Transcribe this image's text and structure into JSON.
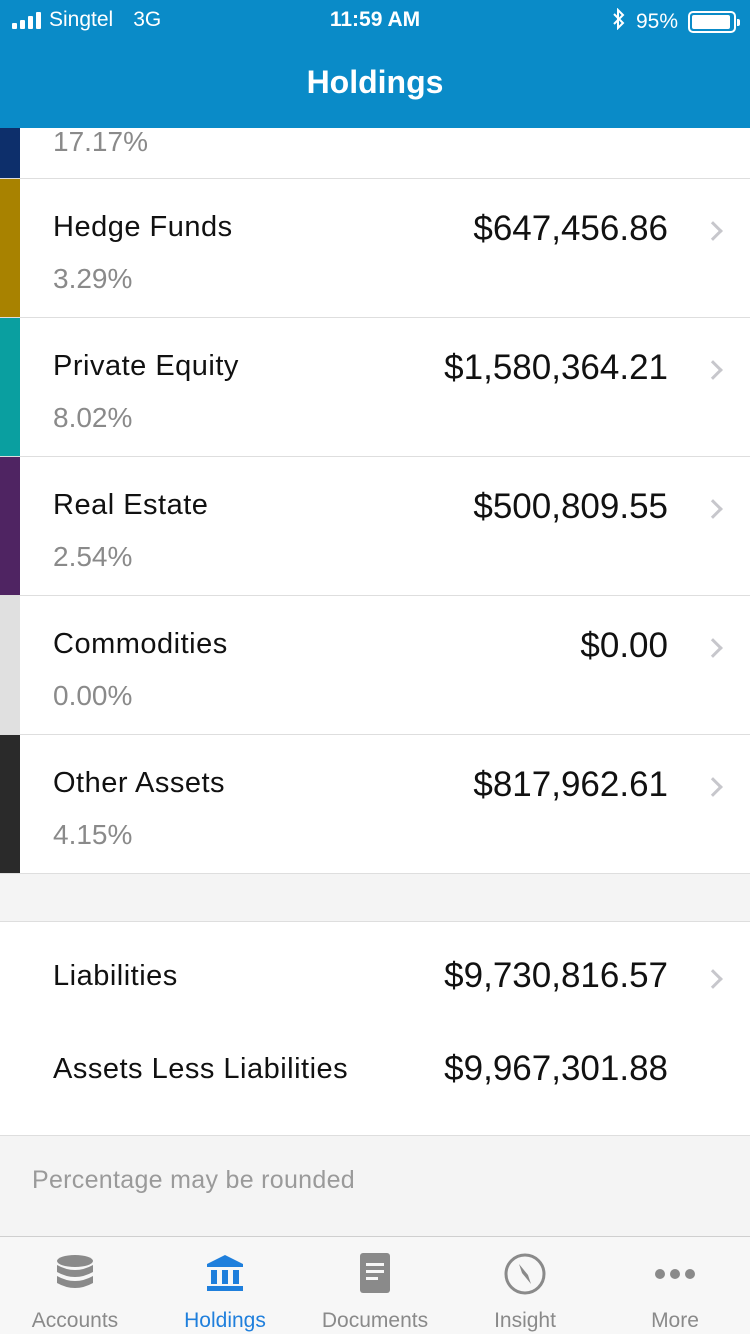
{
  "status_bar": {
    "carrier": "Singtel",
    "network": "3G",
    "time": "11:59 AM",
    "battery": "95%",
    "battery_level": 0.95
  },
  "header": {
    "title": "Holdings"
  },
  "assets": [
    {
      "name": "",
      "percent": "17.17%",
      "amount": "",
      "color": "#0d2f6b"
    },
    {
      "name": "Hedge Funds",
      "percent": "3.29%",
      "amount": "$647,456.86",
      "color": "#a88200"
    },
    {
      "name": "Private Equity",
      "percent": "8.02%",
      "amount": "$1,580,364.21",
      "color": "#0a9fa0"
    },
    {
      "name": "Real Estate",
      "percent": "2.54%",
      "amount": "$500,809.55",
      "color": "#4f2462"
    },
    {
      "name": "Commodities",
      "percent": "0.00%",
      "amount": "$0.00",
      "color": "#e0e0e0"
    },
    {
      "name": "Other Assets",
      "percent": "4.15%",
      "amount": "$817,962.61",
      "color": "#2a2a2a"
    }
  ],
  "summary": {
    "liabilities_label": "Liabilities",
    "liabilities_amount": "$9,730,816.57",
    "net_label": "Assets Less Liabilities",
    "net_amount": "$9,967,301.88"
  },
  "note": "Percentage may be rounded",
  "tabs": [
    {
      "label": "Accounts",
      "icon": "database-icon"
    },
    {
      "label": "Holdings",
      "icon": "bank-icon",
      "active": true
    },
    {
      "label": "Documents",
      "icon": "document-icon"
    },
    {
      "label": "Insight",
      "icon": "compass-icon"
    },
    {
      "label": "More",
      "icon": "more-dots-icon"
    }
  ],
  "colors": {
    "header": "#0a8bc8",
    "tab_active": "#1f7fdc",
    "tab_inactive": "#8a8a8a"
  }
}
